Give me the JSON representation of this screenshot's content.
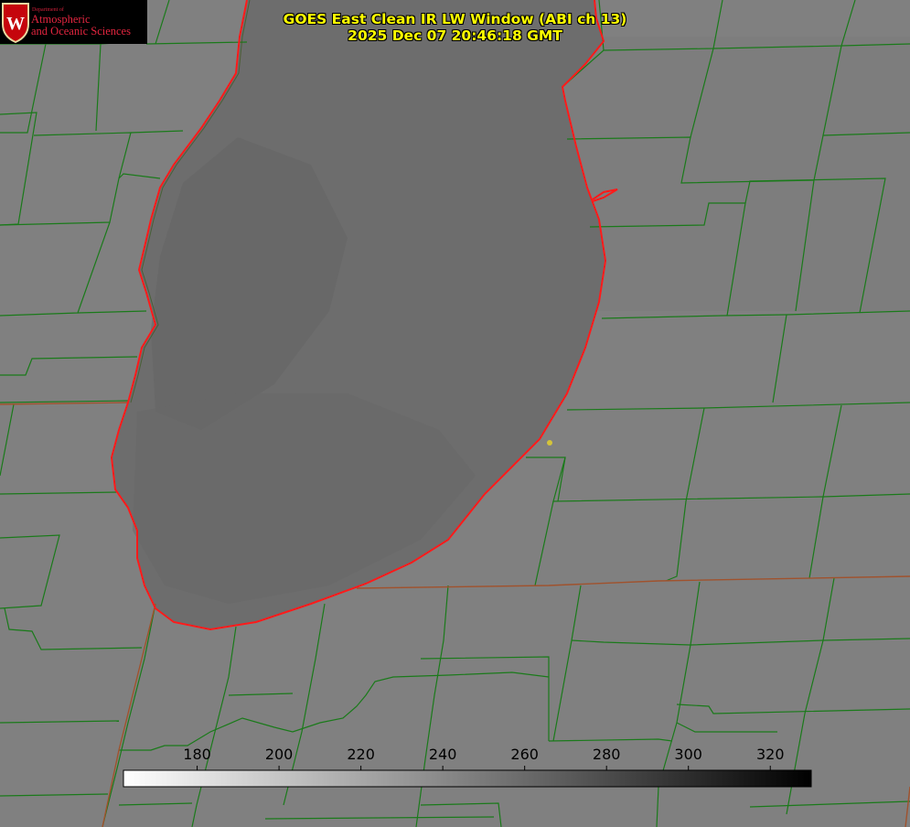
{
  "title": {
    "line1": "GOES East Clean IR LW Window (ABI ch 13)",
    "line2": "2025 Dec 07 20:46:18 GMT"
  },
  "logo": {
    "dept": "Department of",
    "line1": "Atmospheric",
    "line2": "and Oceanic Sciences",
    "badge_letter": "W",
    "brand_color": "#c5050c"
  },
  "colorbar": {
    "min": 162,
    "max": 330,
    "ticks": [
      180,
      200,
      220,
      240,
      260,
      280,
      300,
      320
    ],
    "gradient": [
      "#ffffff",
      "#000000"
    ]
  },
  "colors": {
    "background": "#7f7f7f",
    "lake_fill": "#6e6e6e",
    "county_border": "#1a7a1a",
    "coastline": "#ff1a1a",
    "state_border": "#a0522d",
    "title_text": "#ffff00",
    "marker": "#d4c43a"
  }
}
